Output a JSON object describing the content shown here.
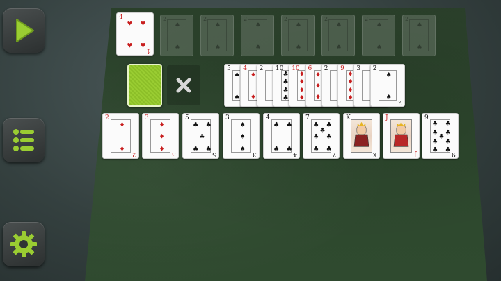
{
  "sidebar": {
    "play_icon": "play-icon",
    "menu_icon": "menu-icon",
    "settings_icon": "gear-icon",
    "accent": "#9acd32"
  },
  "foundation_top": {
    "rank": "4",
    "suit": "♥",
    "color": "red"
  },
  "foundation_slots": [
    {
      "rank": "2",
      "suit": "♣"
    },
    {
      "rank": "2",
      "suit": "♣"
    },
    {
      "rank": "2",
      "suit": "♣"
    },
    {
      "rank": "2",
      "suit": "♣"
    },
    {
      "rank": "2",
      "suit": "♣"
    },
    {
      "rank": "2",
      "suit": "♣"
    },
    {
      "rank": "2",
      "suit": "♣"
    }
  ],
  "stock": {
    "empty_slot_icon": "close-icon"
  },
  "waste_fan": [
    {
      "rank": "5",
      "suit": "♠",
      "color": "black"
    },
    {
      "rank": "4",
      "suit": "♦",
      "color": "red"
    },
    {
      "rank": "2",
      "suit": "♠",
      "color": "black"
    },
    {
      "rank": "10",
      "suit": "♣",
      "color": "black"
    },
    {
      "rank": "10",
      "suit": "♦",
      "color": "red"
    },
    {
      "rank": "6",
      "suit": "♦",
      "color": "red"
    },
    {
      "rank": "2",
      "suit": "♠",
      "color": "black"
    },
    {
      "rank": "9",
      "suit": "♦",
      "color": "red"
    },
    {
      "rank": "3",
      "suit": "♠",
      "color": "black"
    },
    {
      "rank": "2",
      "suit": "♠",
      "color": "black"
    }
  ],
  "tableau": [
    {
      "rank": "2",
      "suit": "♦",
      "color": "red"
    },
    {
      "rank": "3",
      "suit": "♦",
      "color": "red"
    },
    {
      "rank": "5",
      "suit": "♣",
      "color": "black"
    },
    {
      "rank": "3",
      "suit": "♠",
      "color": "black"
    },
    {
      "rank": "4",
      "suit": "♣",
      "color": "black"
    },
    {
      "rank": "7",
      "suit": "♣",
      "color": "black"
    },
    {
      "rank": "K",
      "suit": "♠",
      "color": "black"
    },
    {
      "rank": "J",
      "suit": "♥",
      "color": "red"
    },
    {
      "rank": "9",
      "suit": "♣",
      "color": "black"
    }
  ]
}
